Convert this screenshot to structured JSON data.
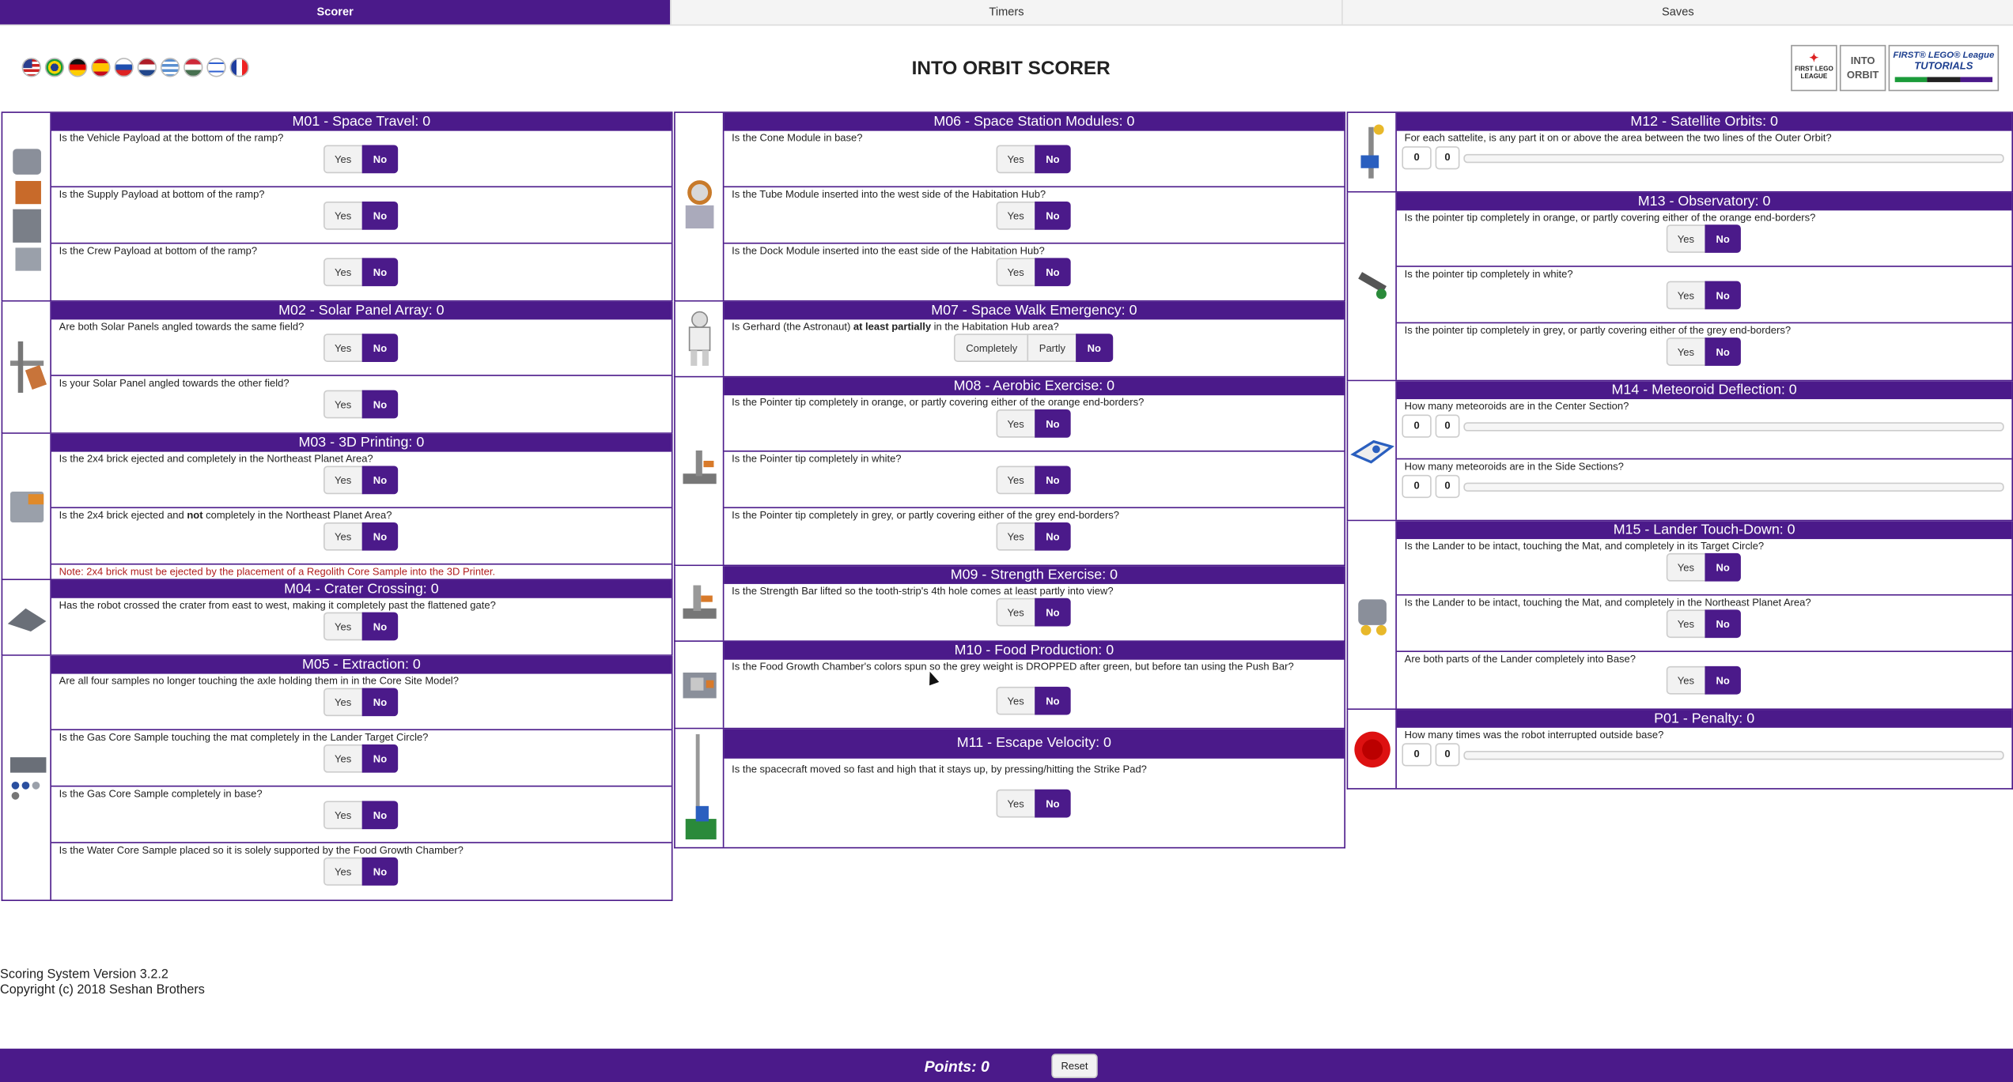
{
  "tabs": [
    "Scorer",
    "Timers",
    "Saves"
  ],
  "title": "INTO ORBIT SCORER",
  "logos": {
    "fll": "FIRST LEGO LEAGUE",
    "orbit": "INTO ORBIT",
    "tut_top": "FIRST® LEGO® League",
    "tut_bottom": "TUTORIALS"
  },
  "flags": [
    "us-flag-icon",
    "brazil-flag-icon",
    "germany-flag-icon",
    "spain-flag-icon",
    "slovenia-flag-icon",
    "netherlands-flag-icon",
    "greece-flag-icon",
    "hungary-flag-icon",
    "israel-flag-icon",
    "france-flag-icon"
  ],
  "opts": {
    "yes": "Yes",
    "no": "No",
    "completely": "Completely",
    "partly": "Partly"
  },
  "m01": {
    "title": "M01 - Space Travel: 0",
    "q1": "Is the Vehicle Payload at the bottom of the ramp?",
    "q2": "Is the Supply Payload at bottom of the ramp?",
    "q3": "Is the Crew Payload at bottom of the ramp?"
  },
  "m02": {
    "title": "M02 - Solar Panel Array: 0",
    "q1": "Are both Solar Panels angled towards the same field?",
    "q2": "Is your Solar Panel angled towards the other field?"
  },
  "m03": {
    "title": "M03 - 3D Printing: 0",
    "q1": "Is the 2x4 brick ejected and completely in the Northeast Planet Area?",
    "q2a": "Is the 2x4 brick ejected and ",
    "q2b": "not",
    "q2c": " completely in the Northeast Planet Area?",
    "note": "Note: 2x4 brick must be ejected by the placement of a Regolith Core Sample into the 3D Printer."
  },
  "m04": {
    "title": "M04 - Crater Crossing: 0",
    "q1": "Has the robot crossed the crater from east to west, making it completely past the flattened gate?"
  },
  "m05": {
    "title": "M05 - Extraction: 0",
    "q1": "Are all four samples no longer touching the axle holding them in in the Core Site Model?",
    "q2": "Is the Gas Core Sample touching the mat completely in the Lander Target Circle?",
    "q3": "Is the Gas Core Sample completely in base?",
    "q4": "Is the Water Core Sample placed so it is solely supported by the Food Growth Chamber?"
  },
  "m06": {
    "title": "M06 - Space Station Modules: 0",
    "q1": "Is the Cone Module in base?",
    "q2": "Is the Tube Module inserted into the west side of the Habitation Hub?",
    "q3": "Is the Dock Module inserted into the east side of the Habitation Hub?"
  },
  "m07": {
    "title": "M07 - Space Walk Emergency: 0",
    "q1a": "Is Gerhard (the Astronaut) ",
    "q1b": "at least partially",
    "q1c": " in the Habitation Hub area?"
  },
  "m08": {
    "title": "M08 - Aerobic Exercise: 0",
    "q1": "Is the Pointer tip completely in orange, or partly covering either of the orange end-borders?",
    "q2": "Is the Pointer tip completely in white?",
    "q3": "Is the Pointer tip completely in grey, or partly covering either of the grey end-borders?"
  },
  "m09": {
    "title": "M09 - Strength Exercise: 0",
    "q1": "Is the Strength Bar lifted so the tooth-strip's 4th hole comes at least partly into view?"
  },
  "m10": {
    "title": "M10 - Food Production: 0",
    "q1": "Is the Food Growth Chamber's colors spun so the grey weight is DROPPED after green, but before tan using the Push Bar?"
  },
  "m11": {
    "title": "M11 - Escape Velocity: 0",
    "q1": "Is the spacecraft moved so fast and high that it stays up, by pressing/hitting the Strike Pad?"
  },
  "m12": {
    "title": "M12 - Satellite Orbits: 0",
    "q1": "For each sattelite, is any part it on or above the area between the two lines of the Outer Orbit?",
    "v1": "0",
    "v2": "0"
  },
  "m13": {
    "title": "M13 - Observatory: 0",
    "q1": "Is the pointer tip completely in orange, or partly covering either of the orange end-borders?",
    "q2": "Is the pointer tip completely in white?",
    "q3": "Is the pointer tip completely in grey, or partly covering either of the grey end-borders?"
  },
  "m14": {
    "title": "M14 - Meteoroid Deflection: 0",
    "q1": "How many meteoroids are in the Center Section?",
    "q2": "How many meteoroids are in the Side Sections?",
    "v1": "0",
    "v2": "0",
    "v3": "0",
    "v4": "0"
  },
  "m15": {
    "title": "M15 - Lander Touch-Down: 0",
    "q1": "Is the Lander to be intact, touching the Mat, and completely in its Target Circle?",
    "q2": "Is the Lander to be intact, touching the Mat, and completely in the Northeast Planet Area?",
    "q3": "Are both parts of the Lander completely into Base?"
  },
  "p01": {
    "title": "P01 - Penalty: 0",
    "q1": "How many times was the robot interrupted outside base?",
    "v1": "0",
    "v2": "0"
  },
  "footer": {
    "version": "Scoring System Version 3.2.2",
    "copyright": "Copyright (c) 2018 Seshan Brothers"
  },
  "bottom": {
    "points": "Points: 0",
    "reset": "Reset"
  },
  "colors": {
    "accent": "#4b1a8a",
    "note": "#b11e1e"
  }
}
